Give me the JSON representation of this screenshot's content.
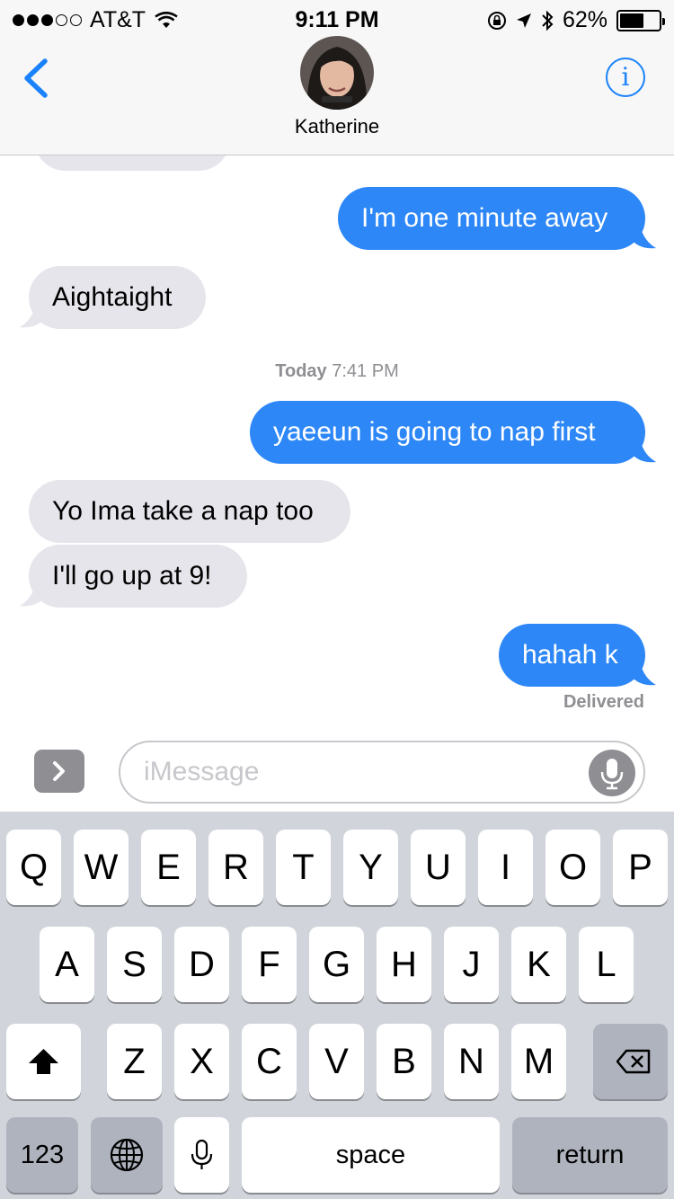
{
  "status_bar": {
    "carrier": "AT&T",
    "time": "9:11 PM",
    "battery_percent": "62%",
    "battery_level": 0.62
  },
  "header": {
    "contact_name": "Katherine",
    "info_label": "i"
  },
  "messages": [
    {
      "direction": "incoming",
      "text": ""
    },
    {
      "direction": "outgoing",
      "text": "I'm one minute away"
    },
    {
      "direction": "incoming",
      "text": "Aightaight"
    },
    {
      "direction": "outgoing",
      "text": "yaeeun is going to nap first"
    },
    {
      "direction": "incoming",
      "text": "Yo Ima take a nap too"
    },
    {
      "direction": "incoming",
      "text": "I'll go up at 9!"
    },
    {
      "direction": "outgoing",
      "text": "hahah k"
    }
  ],
  "timestamp": {
    "day": "Today",
    "time": "7:41 PM"
  },
  "delivery_status": "Delivered",
  "input": {
    "placeholder": "iMessage"
  },
  "keyboard": {
    "row1": [
      "Q",
      "W",
      "E",
      "R",
      "T",
      "Y",
      "U",
      "I",
      "O",
      "P"
    ],
    "row2": [
      "A",
      "S",
      "D",
      "F",
      "G",
      "H",
      "J",
      "K",
      "L"
    ],
    "row3": [
      "Z",
      "X",
      "C",
      "V",
      "B",
      "N",
      "M"
    ],
    "numbers_label": "123",
    "space_label": "space",
    "return_label": "return"
  },
  "colors": {
    "accent": "#1a82fb",
    "outgoing_bubble": "#2d87f7",
    "incoming_bubble": "#e6e5eb",
    "keyboard_bg": "#d1d5db"
  }
}
